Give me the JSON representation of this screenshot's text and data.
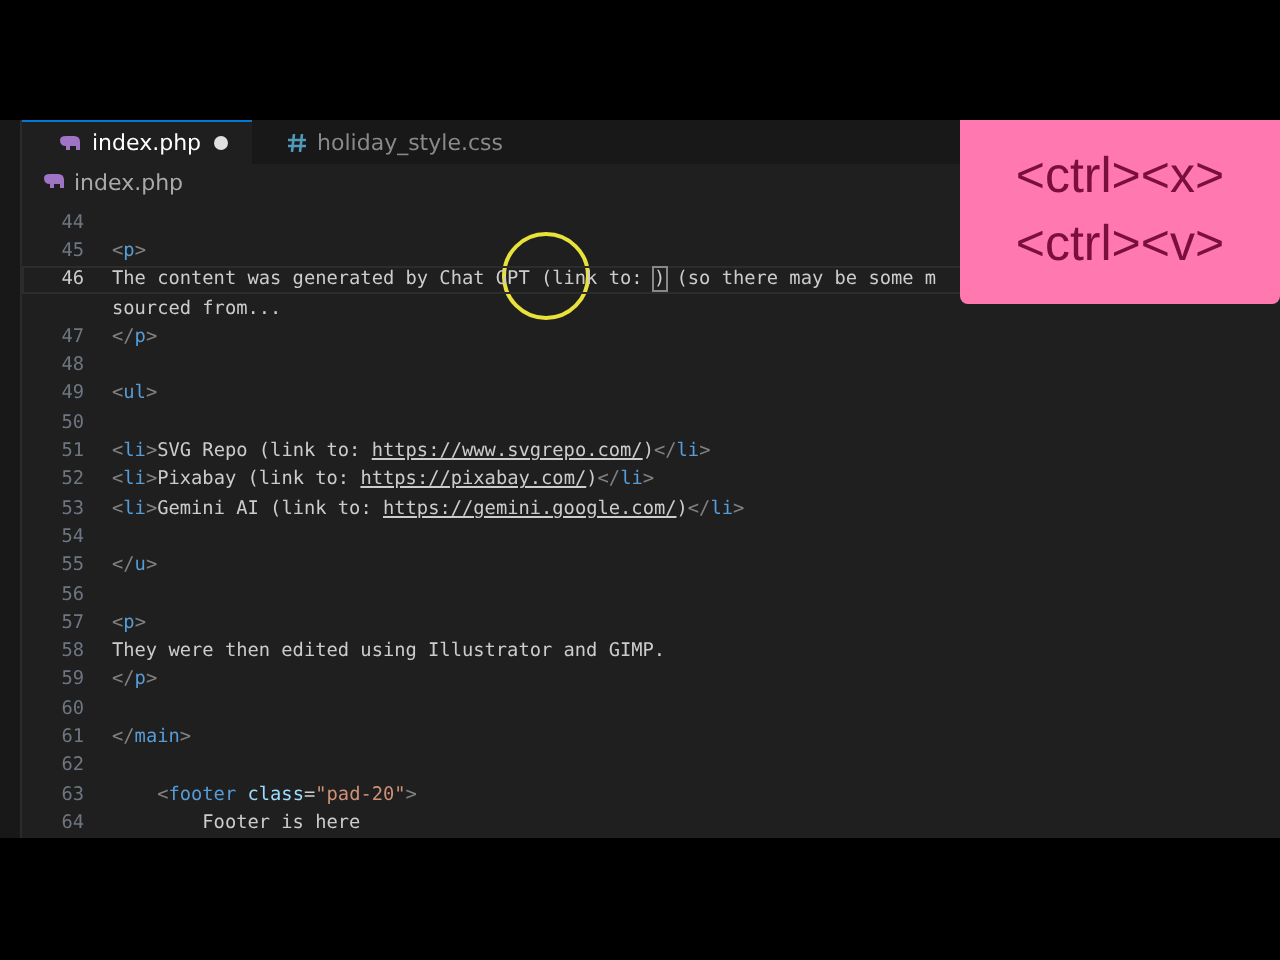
{
  "tabs": [
    {
      "label": "index.php",
      "modified": true,
      "selected": true
    },
    {
      "label": "holiday_style.css",
      "modified": false,
      "selected": false
    }
  ],
  "breadcrumb": {
    "label": "index.php"
  },
  "lines": [
    {
      "number": "44",
      "current": false
    },
    {
      "number": "45",
      "current": false,
      "tokens": [
        {
          "kind": "punct",
          "text": "<"
        },
        {
          "kind": "tag",
          "text": "p"
        },
        {
          "kind": "punct",
          "text": ">"
        }
      ]
    },
    {
      "number": "46",
      "current": true,
      "tokens": [
        {
          "kind": "text",
          "text": "The content was generated by Chat GPT (link to: "
        },
        {
          "kind": "bracket",
          "text": ")"
        },
        {
          "kind": "text",
          "text": " (so there may be some m"
        }
      ]
    },
    {
      "current": false,
      "tokens": [
        {
          "kind": "text",
          "text": "sourced from..."
        }
      ]
    },
    {
      "number": "47",
      "current": false,
      "tokens": [
        {
          "kind": "punct",
          "text": "</"
        },
        {
          "kind": "tag",
          "text": "p"
        },
        {
          "kind": "punct",
          "text": ">"
        }
      ]
    },
    {
      "number": "48",
      "current": false
    },
    {
      "number": "49",
      "current": false,
      "tokens": [
        {
          "kind": "punct",
          "text": "<"
        },
        {
          "kind": "tag",
          "text": "ul"
        },
        {
          "kind": "punct",
          "text": ">"
        }
      ]
    },
    {
      "number": "50",
      "current": false
    },
    {
      "number": "51",
      "current": false,
      "tokens": [
        {
          "kind": "punct",
          "text": "<"
        },
        {
          "kind": "tag",
          "text": "li"
        },
        {
          "kind": "punct",
          "text": ">"
        },
        {
          "kind": "text",
          "text": "SVG Repo (link to: "
        },
        {
          "kind": "link",
          "text": "https://www.svgrepo.com/"
        },
        {
          "kind": "text",
          "text": ")"
        },
        {
          "kind": "punct",
          "text": "</"
        },
        {
          "kind": "tag",
          "text": "li"
        },
        {
          "kind": "punct",
          "text": ">"
        }
      ]
    },
    {
      "number": "52",
      "current": false,
      "tokens": [
        {
          "kind": "punct",
          "text": "<"
        },
        {
          "kind": "tag",
          "text": "li"
        },
        {
          "kind": "punct",
          "text": ">"
        },
        {
          "kind": "text",
          "text": "Pixabay (link to: "
        },
        {
          "kind": "link",
          "text": "https://pixabay.com/"
        },
        {
          "kind": "text",
          "text": ")"
        },
        {
          "kind": "punct",
          "text": "</"
        },
        {
          "kind": "tag",
          "text": "li"
        },
        {
          "kind": "punct",
          "text": ">"
        }
      ]
    },
    {
      "number": "53",
      "current": false,
      "tokens": [
        {
          "kind": "punct",
          "text": "<"
        },
        {
          "kind": "tag",
          "text": "li"
        },
        {
          "kind": "punct",
          "text": ">"
        },
        {
          "kind": "text",
          "text": "Gemini AI (link to: "
        },
        {
          "kind": "link",
          "text": "https://gemini.google.com/"
        },
        {
          "kind": "text",
          "text": ")"
        },
        {
          "kind": "punct",
          "text": "</"
        },
        {
          "kind": "tag",
          "text": "li"
        },
        {
          "kind": "punct",
          "text": ">"
        }
      ]
    },
    {
      "number": "54",
      "current": false
    },
    {
      "number": "55",
      "current": false,
      "tokens": [
        {
          "kind": "punct",
          "text": "</"
        },
        {
          "kind": "tag",
          "text": "u"
        },
        {
          "kind": "punct",
          "text": ">"
        }
      ]
    },
    {
      "number": "56",
      "current": false
    },
    {
      "number": "57",
      "current": false,
      "tokens": [
        {
          "kind": "punct",
          "text": "<"
        },
        {
          "kind": "tag",
          "text": "p"
        },
        {
          "kind": "punct",
          "text": ">"
        }
      ]
    },
    {
      "number": "58",
      "current": false,
      "tokens": [
        {
          "kind": "text",
          "text": "They were then edited using Illustrator and GIMP."
        }
      ]
    },
    {
      "number": "59",
      "current": false,
      "tokens": [
        {
          "kind": "punct",
          "text": "</"
        },
        {
          "kind": "tag",
          "text": "p"
        },
        {
          "kind": "punct",
          "text": ">"
        }
      ]
    },
    {
      "number": "60",
      "current": false
    },
    {
      "number": "61",
      "current": false,
      "tokens": [
        {
          "kind": "punct",
          "text": "</"
        },
        {
          "kind": "tag",
          "text": "main"
        },
        {
          "kind": "punct",
          "text": ">"
        }
      ]
    },
    {
      "number": "62",
      "current": false
    },
    {
      "number": "63",
      "current": false,
      "tokens": [
        {
          "kind": "punct",
          "text": "    <"
        },
        {
          "kind": "tag",
          "text": "footer"
        },
        {
          "kind": "attr",
          "text": " class"
        },
        {
          "kind": "text",
          "text": "="
        },
        {
          "kind": "string",
          "text": "\"pad-20\""
        },
        {
          "kind": "punct",
          "text": ">"
        }
      ]
    },
    {
      "number": "64",
      "current": false,
      "tokens": [
        {
          "kind": "text",
          "text": "        Footer is here"
        }
      ]
    }
  ],
  "key_overlay": {
    "lines": [
      "<ctrl><x>",
      "<ctrl><v>"
    ]
  }
}
